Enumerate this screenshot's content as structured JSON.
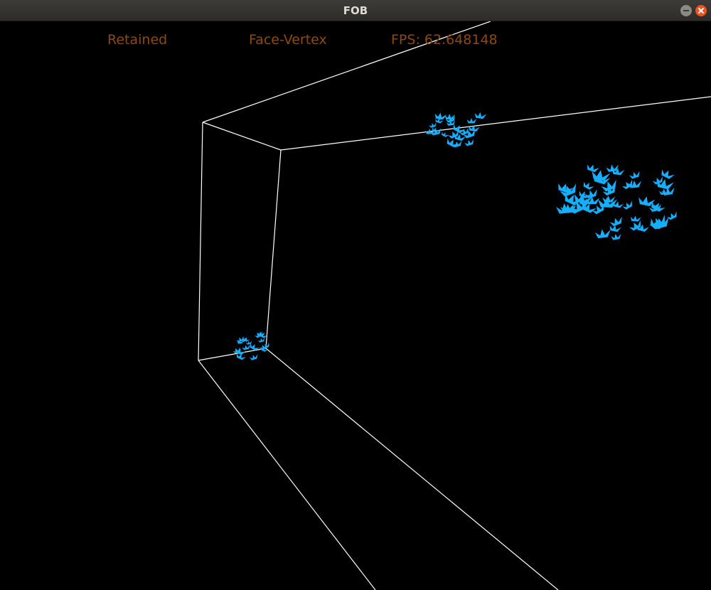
{
  "window": {
    "title": "FOB"
  },
  "hud": {
    "mode": "Retained",
    "format": "Face-Vertex",
    "fps": "FPS: 62.648148"
  },
  "colors": {
    "background": "#000000",
    "wireframe": "#ffffff",
    "boids": "#14b0ff",
    "hud_text": "#8b4a12"
  },
  "icons": {
    "minimize": "minimize-icon",
    "close": "close-icon"
  }
}
